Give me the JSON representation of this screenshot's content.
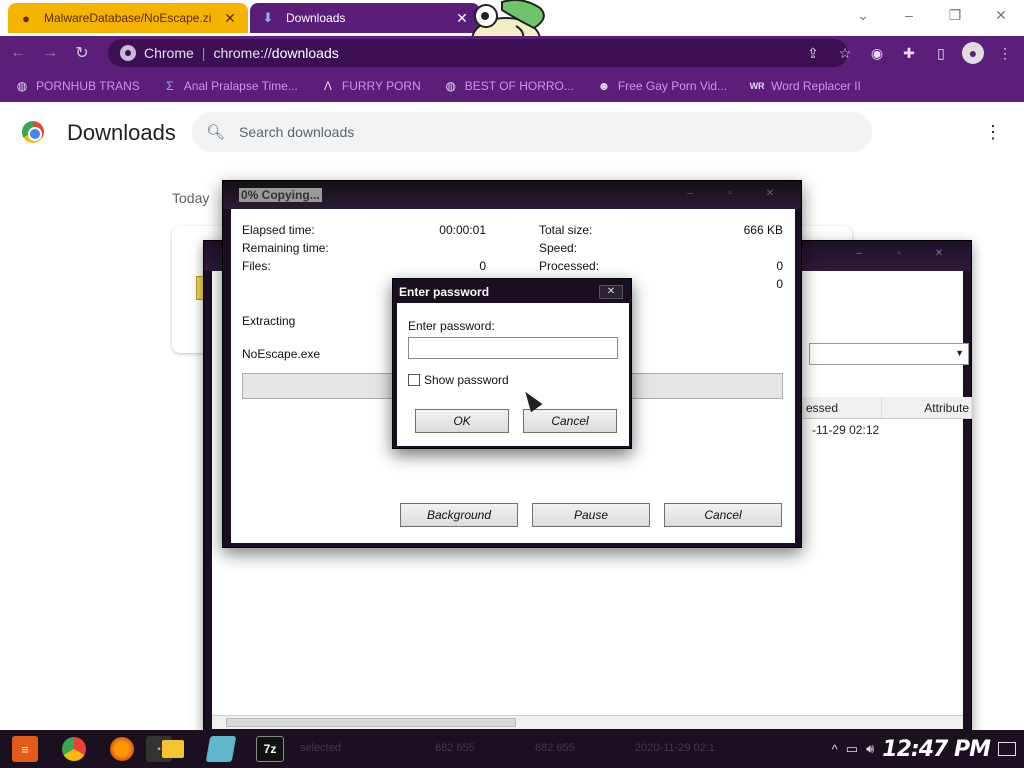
{
  "browser": {
    "tabs": [
      {
        "title": "MalwareDatabase/NoEscape.zi",
        "icon": "github-icon",
        "close": "✕"
      },
      {
        "title": "Downloads",
        "icon": "download-icon",
        "close": "✕"
      }
    ],
    "window_controls": {
      "minimize": "⌄",
      "min": "–",
      "restore": "❐",
      "close": "✕"
    },
    "omnibox": {
      "site_label": "Chrome",
      "url_prefix": "chrome://",
      "url_bold": "downloads"
    },
    "bookmarks": [
      {
        "label": "PORNHUB TRANS",
        "icon": "globe-icon"
      },
      {
        "label": "Anal Pralapse Time...",
        "icon": "sigma-icon"
      },
      {
        "label": "FURRY PORN",
        "icon": "lambda-icon"
      },
      {
        "label": "BEST OF HORRO...",
        "icon": "globe-icon"
      },
      {
        "label": "Free Gay Porn Vid...",
        "icon": "mask-icon"
      },
      {
        "label": "Word Replacer II",
        "icon": "wr-icon"
      }
    ],
    "accent_color": "#5b1f7a"
  },
  "downloads_page": {
    "title": "Downloads",
    "search_placeholder": "Search downloads",
    "section_today": "Today"
  },
  "progress_window": {
    "title": "0% Copying...",
    "elapsed_label": "Elapsed time:",
    "elapsed_value": "00:00:01",
    "remaining_label": "Remaining time:",
    "files_label": "Files:",
    "files_value": "0",
    "total_size_label": "Total size:",
    "total_size_value": "666 KB",
    "speed_label": "Speed:",
    "processed_label": "Processed:",
    "processed_value": "0",
    "extra_value": "0",
    "status_label": "Extracting",
    "filename": "NoEscape.exe",
    "progress_percent": 0,
    "buttons": {
      "background": "Background",
      "pause": "Pause",
      "cancel": "Cancel"
    }
  },
  "file_manager": {
    "columns": {
      "processed_partial": "essed",
      "attributes_partial": "Attribute"
    },
    "row_date": "-11-29 02:12",
    "status_bar": {
      "selected": "selected",
      "size1": "682 655",
      "size2": "682 655",
      "date": "2020-11-29 02:1"
    }
  },
  "password_dialog": {
    "title": "Enter password",
    "close": "✕",
    "label": "Enter password:",
    "input_value": "",
    "show_password_label": "Show password",
    "show_password_checked": false,
    "ok": "OK",
    "cancel": "Cancel"
  },
  "taskbar": {
    "apps": [
      "start-icon",
      "chrome-icon",
      "firefox-icon",
      "terminal-icon",
      "folder-icon",
      "app-icon",
      "7zip-icon"
    ],
    "sevenzip_label": "7z",
    "clock": "12:47 PM"
  }
}
